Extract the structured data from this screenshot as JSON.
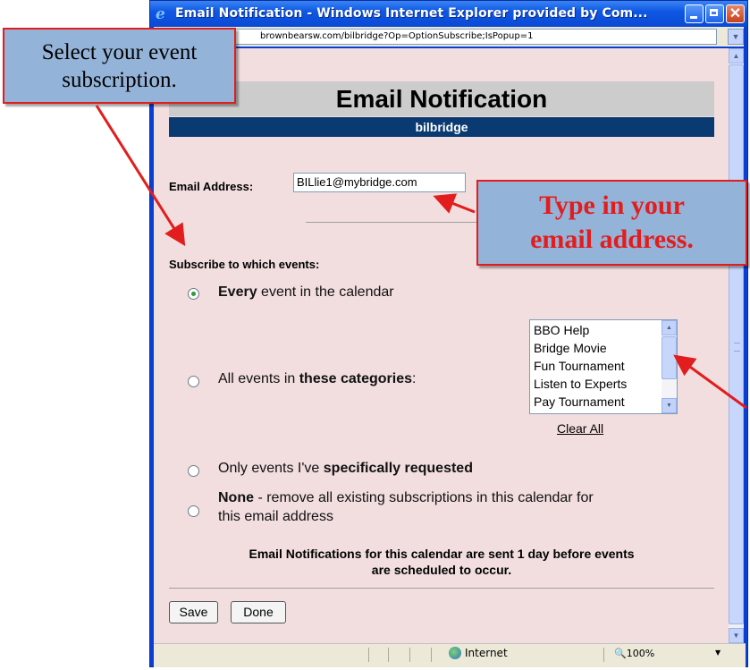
{
  "window": {
    "title": "Email Notification - Windows Internet Explorer provided by Com...",
    "address": "brownbearsw.com/bilbridge?Op=OptionSubscribe;IsPopup=1"
  },
  "page": {
    "header": "Email Notification",
    "subheader": "bilbridge",
    "email_label": "Email Address:",
    "email_value": "BILlie1@mybridge.com",
    "subscribe_heading": "Subscribe to which events:",
    "options": [
      {
        "bold": "Every",
        "rest": " event in the calendar",
        "checked": true
      },
      {
        "pre": "All events in ",
        "bold": "these categories",
        "post": ":",
        "checked": false
      },
      {
        "pre": "Only events I've ",
        "bold": "specifically requested",
        "checked": false
      },
      {
        "bold": "None",
        "rest": " - remove all existing subscriptions in this calendar for",
        "line2": "this email address",
        "checked": false
      }
    ],
    "categories": [
      "BBO Help",
      "Bridge Movie",
      "Fun Tournament",
      "Listen to Experts",
      "Pay Tournament"
    ],
    "clear_all": "Clear All",
    "notice_line1": "Email Notifications for this calendar are sent 1 day before events",
    "notice_line2": "are scheduled to occur.",
    "save_label": "Save",
    "done_label": "Done"
  },
  "statusbar": {
    "zone": "Internet",
    "zoom": "100%"
  },
  "callouts": {
    "left_line1": "Select your event",
    "left_line2": "subscription.",
    "right_line1": "Type in your",
    "right_line2": "email address."
  },
  "colors": {
    "page_background": "#f2dede",
    "header_bar": "#0a3a72",
    "callout_fill": "#94b3d8",
    "callout_border": "#e21d1d"
  }
}
